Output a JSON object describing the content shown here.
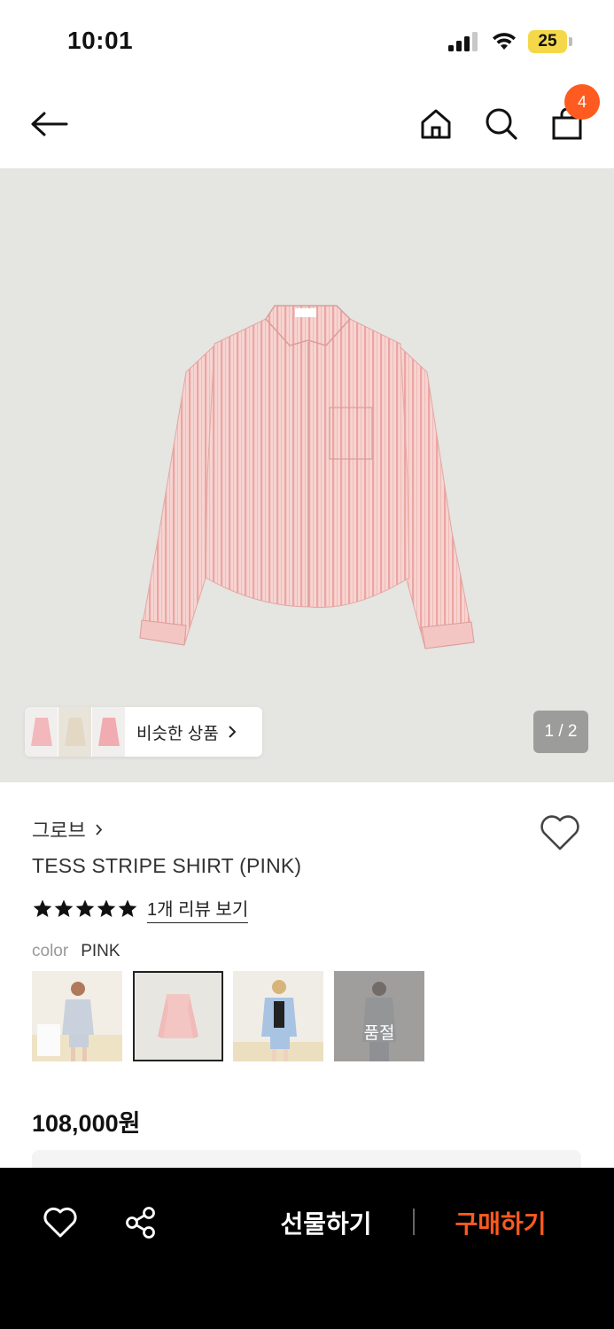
{
  "status_bar": {
    "time": "10:01",
    "battery": "25"
  },
  "header": {
    "cart_count": "4"
  },
  "gallery": {
    "similar_label": "비슷한 상품",
    "page_indicator": "1 / 2"
  },
  "product": {
    "brand": "그로브",
    "title": "TESS STRIPE SHIRT (PINK)",
    "rating_stars": 5,
    "review_link": "1개 리뷰 보기",
    "color_label": "color",
    "color_value": "PINK",
    "swatches": [
      {
        "name": "grey-set",
        "state": ""
      },
      {
        "name": "pink",
        "state": "selected"
      },
      {
        "name": "blue",
        "state": ""
      },
      {
        "name": "grey",
        "state": "품절"
      }
    ],
    "price": "108,000원"
  },
  "bottom_bar": {
    "gift_label": "선물하기",
    "buy_label": "구매하기"
  },
  "colors": {
    "accent": "#ff5a1f",
    "hero_bg": "#e5e5e1",
    "shirt_pink": "#f3c6c3",
    "bottom_bar": "#000000"
  }
}
